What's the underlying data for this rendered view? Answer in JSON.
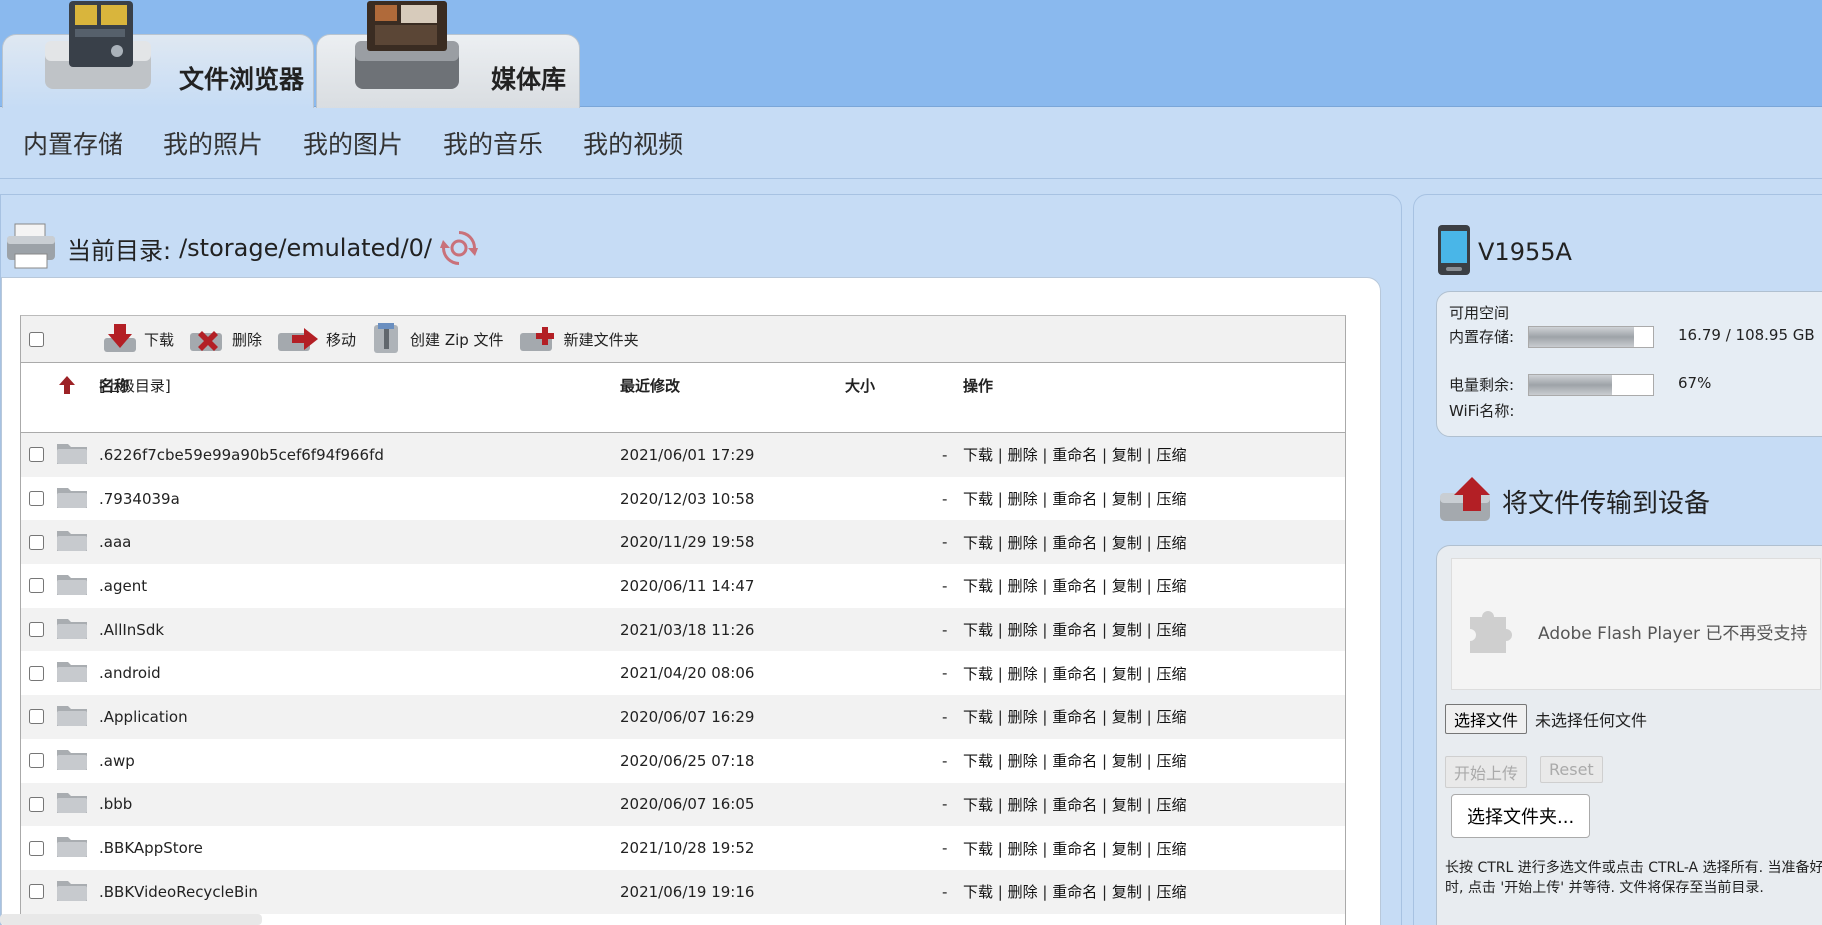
{
  "tabs": [
    {
      "label": "文件浏览器",
      "active": true
    },
    {
      "label": "媒体库",
      "active": false
    }
  ],
  "sub_nav": [
    "内置存储",
    "我的照片",
    "我的图片",
    "我的音乐",
    "我的视频"
  ],
  "dir": {
    "prefix": "当前目录:",
    "path": "/storage/emulated/0/"
  },
  "toolbar": {
    "download": "下载",
    "delete": "删除",
    "move": "移动",
    "zip": "创建 Zip 文件",
    "new_folder": "新建文件夹"
  },
  "columns": {
    "name": "名称",
    "modified": "最近修改",
    "size": "大小",
    "actions": "操作"
  },
  "parent_dir": "[上级目录]",
  "actions": [
    "下载",
    "删除",
    "重命名",
    "复制",
    "压缩"
  ],
  "files": [
    {
      "name": ".6226f7cbe59e99a90b5cef6f94f966fd",
      "date": "2021/06/01 17:29",
      "size": "-"
    },
    {
      "name": ".7934039a",
      "date": "2020/12/03 10:58",
      "size": "-"
    },
    {
      "name": ".aaa",
      "date": "2020/11/29 19:58",
      "size": "-"
    },
    {
      "name": ".agent",
      "date": "2020/06/11 14:47",
      "size": "-"
    },
    {
      "name": ".AllInSdk",
      "date": "2021/03/18 11:26",
      "size": "-"
    },
    {
      "name": ".android",
      "date": "2021/04/20 08:06",
      "size": "-"
    },
    {
      "name": ".Application",
      "date": "2020/06/07 16:29",
      "size": "-"
    },
    {
      "name": ".awp",
      "date": "2020/06/25 07:18",
      "size": "-"
    },
    {
      "name": ".bbb",
      "date": "2020/06/07 16:05",
      "size": "-"
    },
    {
      "name": ".BBKAppStore",
      "date": "2021/10/28 19:52",
      "size": "-"
    },
    {
      "name": ".BBKVideoRecycleBin",
      "date": "2021/06/19 19:16",
      "size": "-"
    }
  ],
  "device": {
    "name": "V1955A",
    "free_space_label": "可用空间",
    "storage_label": "内置存储:",
    "storage_value": "16.79 / 108.95 GB",
    "storage_fill": 0.85,
    "battery_label": "电量剩余:",
    "battery_value": "67%",
    "battery_fill": 0.67,
    "wifi_label": "WiFi名称:"
  },
  "upload": {
    "title": "将文件传输到设备",
    "flash_message": "Adobe Flash Player 已不再受支持",
    "choose_file": "选择文件",
    "no_file": "未选择任何文件",
    "start_upload": "开始上传",
    "reset": "Reset",
    "choose_folder": "选择文件夹...",
    "help": "长按 CTRL 进行多选文件或点击 CTRL-A 选择所有. 当准备好时, 点击 '开始上传' 并等待. 文件将保存至当前目录."
  }
}
